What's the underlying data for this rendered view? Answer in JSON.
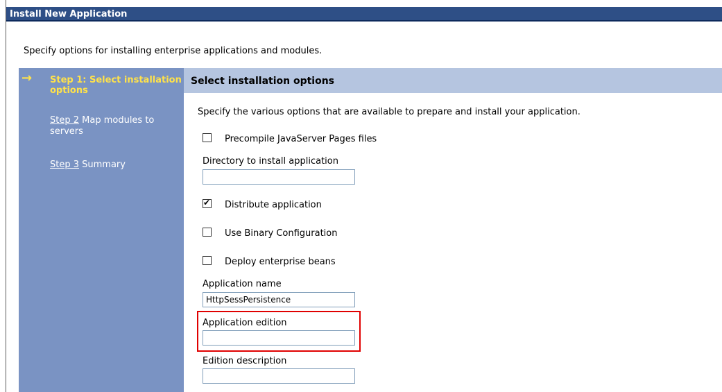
{
  "window": {
    "title": "Install New Application"
  },
  "intro_text": "Specify options for installing enterprise applications and modules.",
  "nav": {
    "current_arrow": "→",
    "step1_label": "Step 1: Select installation options",
    "step2_link": "Step 2",
    "step2_text": " Map modules to servers",
    "step3_link": "Step 3",
    "step3_text": " Summary"
  },
  "panel": {
    "header": "Select installation options",
    "description": "Specify the various options that are available to prepare and install your application.",
    "precompile_label": "Precompile JavaServer Pages files",
    "precompile_checked": false,
    "directory_label": "Directory to install application",
    "directory_value": "",
    "distribute_label": "Distribute application",
    "distribute_checked": true,
    "binary_label": "Use Binary Configuration",
    "binary_checked": false,
    "deploy_label": "Deploy enterprise beans",
    "deploy_checked": false,
    "app_name_label": "Application name",
    "app_name_value": "HttpSessPersistence",
    "edition_label": "Application edition",
    "edition_value": "",
    "edition_desc_label": "Edition description",
    "edition_desc_value": ""
  },
  "colors": {
    "title_bar": "#2e4f86",
    "nav_background": "#7a93c3",
    "nav_current": "#ffe24a",
    "header_background": "#b5c5e0",
    "highlight": "#e00000"
  }
}
